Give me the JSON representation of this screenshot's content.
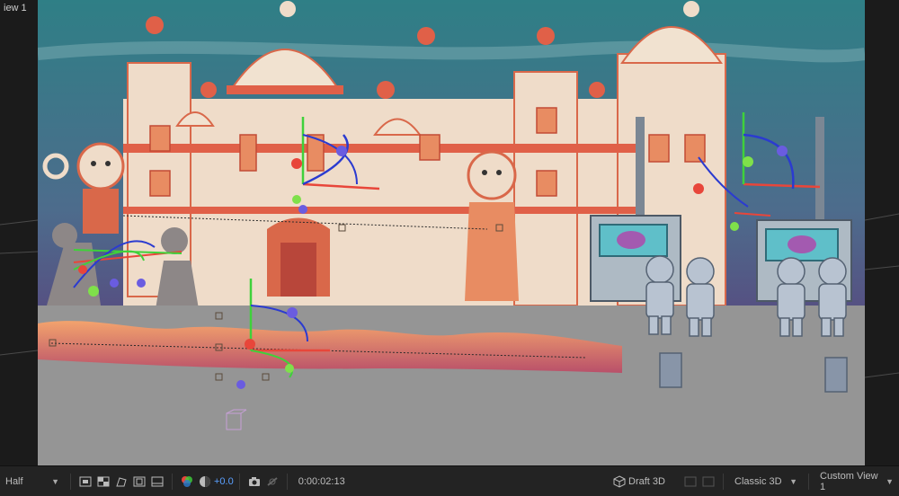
{
  "view": {
    "title": "iew 1"
  },
  "toolbar": {
    "resolution": "Half",
    "exposure": "+0.0",
    "timecode": "0:00:02:13",
    "draft3d": "Draft 3D",
    "renderer": "Classic 3D",
    "view_layout": "Custom View 1"
  },
  "icons": [
    "region-of-interest-icon",
    "transparency-grid-icon",
    "mask-path-icon",
    "safe-margins-icon",
    "3d-ground-plane-icon",
    "color-channel-icon",
    "exposure-reset-icon",
    "snapshot-icon",
    "show-snapshot-icon",
    "draft3d-icon"
  ],
  "colors": {
    "sky_top": "#2d6f7a",
    "ground": "#959595",
    "axis_x": "#e8463a",
    "axis_y": "#3fd13a",
    "axis_z": "#2b3bd0",
    "handle": "#6a5ce0",
    "accent": "#5aa0ff"
  }
}
